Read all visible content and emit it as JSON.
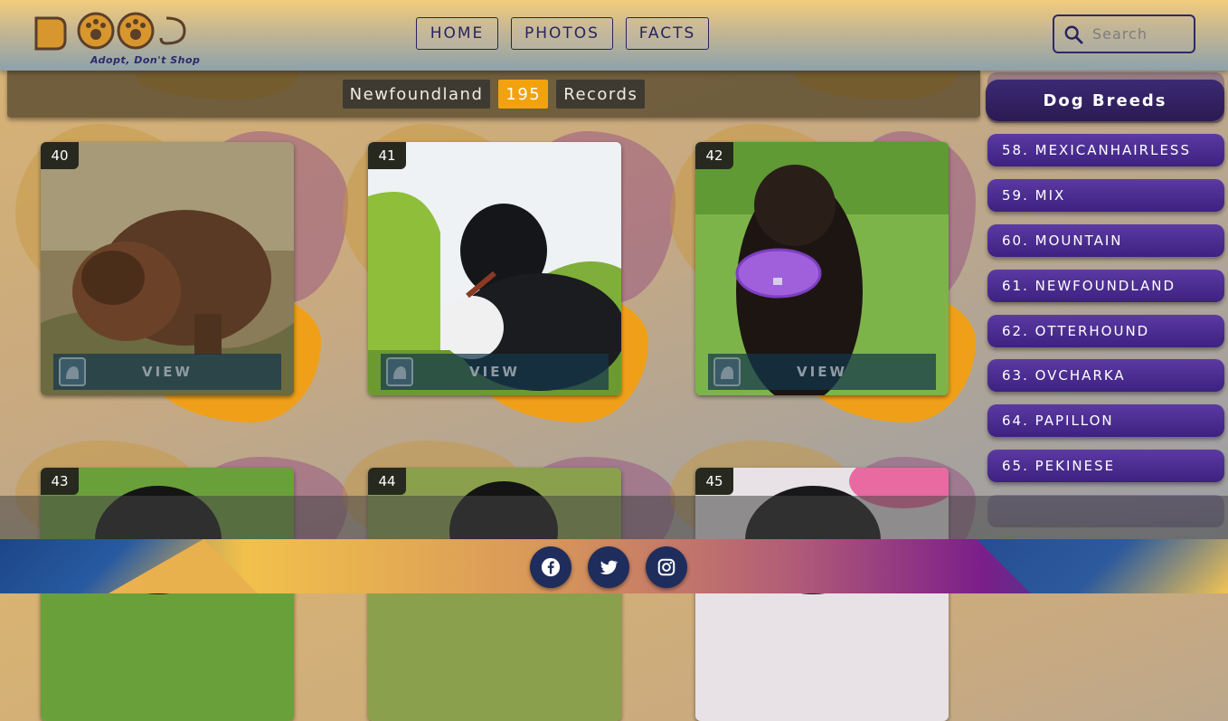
{
  "header": {
    "logo_text": "DOGS",
    "tagline": "Adopt, Don't Shop",
    "nav": [
      "HOME",
      "PHOTOS",
      "FACTS"
    ],
    "search_placeholder": "Search"
  },
  "records_bar": {
    "breed": "Newfoundland",
    "count": "195",
    "suffix": "Records"
  },
  "cards": [
    {
      "number": "40",
      "button": "VIEW"
    },
    {
      "number": "41",
      "button": "VIEW"
    },
    {
      "number": "42",
      "button": "VIEW"
    },
    {
      "number": "43"
    },
    {
      "number": "44"
    },
    {
      "number": "45"
    }
  ],
  "sidebar": {
    "title": "Dog Breeds",
    "items": [
      "58. MEXICANHAIRLESS",
      "59. MIX",
      "60. MOUNTAIN",
      "61. NEWFOUNDLAND",
      "62. OTTERHOUND",
      "63. OVCHARKA",
      "64. PAPILLON",
      "65. PEKINESE"
    ]
  },
  "footer": {
    "social": [
      "facebook-icon",
      "twitter-icon",
      "instagram-icon"
    ]
  },
  "colors": {
    "accent": "#f2a20c",
    "nav_text": "#26245e",
    "sidebar_item": "#4a2c90"
  }
}
